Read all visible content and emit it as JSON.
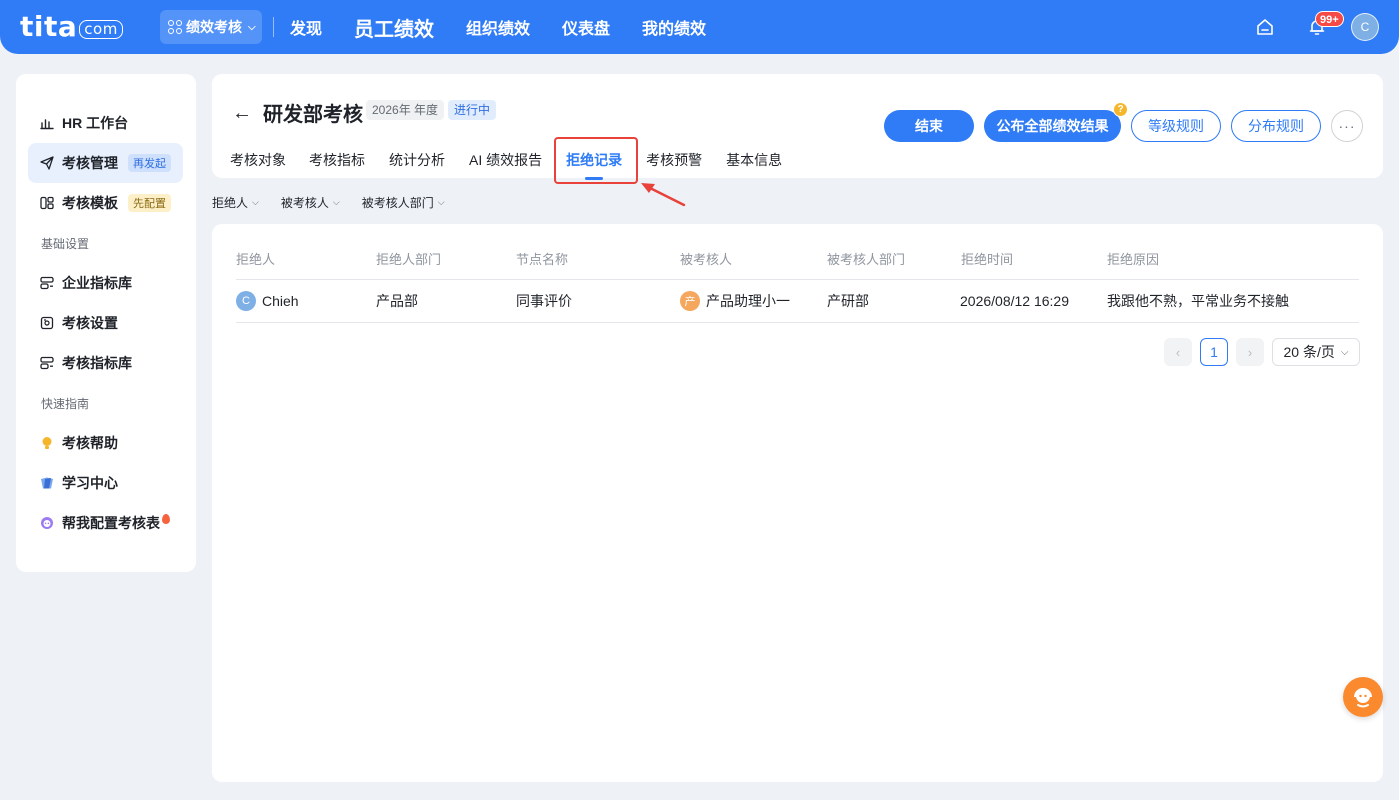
{
  "topbar": {
    "logo_main": "tita",
    "logo_suffix": "com",
    "app_switch": "绩效考核",
    "nav": [
      "发现",
      "员工绩效",
      "组织绩效",
      "仪表盘",
      "我的绩效"
    ],
    "notification_count": "99+",
    "avatar_initial": "C"
  },
  "sidebar": {
    "items": [
      {
        "label": "HR 工作台",
        "icon": "bar-chart-icon"
      },
      {
        "label": "考核管理",
        "icon": "paper-plane-icon",
        "tag": "再发起"
      },
      {
        "label": "考核模板",
        "icon": "template-icon",
        "tag": "先配置"
      }
    ],
    "group_basic": "基础设置",
    "basic_items": [
      {
        "label": "企业指标库",
        "icon": "indicator-icon"
      },
      {
        "label": "考核设置",
        "icon": "settings-doc-icon"
      },
      {
        "label": "考核指标库",
        "icon": "indicator-icon"
      }
    ],
    "group_guide": "快速指南",
    "guide_items": [
      {
        "label": "考核帮助",
        "icon": "bulb-icon"
      },
      {
        "label": "学习中心",
        "icon": "book-icon"
      },
      {
        "label": "帮我配置考核表",
        "icon": "assistant-icon"
      }
    ]
  },
  "header": {
    "title": "研发部考核",
    "year_tag": "2026年 年度",
    "status_tag": "进行中",
    "tabs": [
      "考核对象",
      "考核指标",
      "统计分析",
      "AI 绩效报告",
      "拒绝记录",
      "考核预警",
      "基本信息"
    ],
    "active_tab": "拒绝记录",
    "buttons": {
      "end": "结束",
      "publish": "公布全部绩效结果",
      "level_rules": "等级规则",
      "dist_rules": "分布规则",
      "more": "···"
    },
    "help_badge": "?"
  },
  "filters": [
    "拒绝人",
    "被考核人",
    "被考核人部门"
  ],
  "table": {
    "columns": [
      "拒绝人",
      "拒绝人部门",
      "节点名称",
      "被考核人",
      "被考核人部门",
      "拒绝时间",
      "拒绝原因"
    ],
    "rows": [
      {
        "rejector": "Chieh",
        "rejector_initial": "C",
        "rejector_dept": "产品部",
        "node": "同事评价",
        "assessee": "产品助理小一",
        "assessee_initial": "产",
        "assessee_dept": "产研部",
        "time": "2026/08/12 16:29",
        "reason": "我跟他不熟，平常业务不接触"
      }
    ]
  },
  "pagination": {
    "current": "1",
    "page_size": "20 条/页"
  },
  "colors": {
    "primary": "#2f7cf6",
    "annotation_red": "#e8423a"
  }
}
